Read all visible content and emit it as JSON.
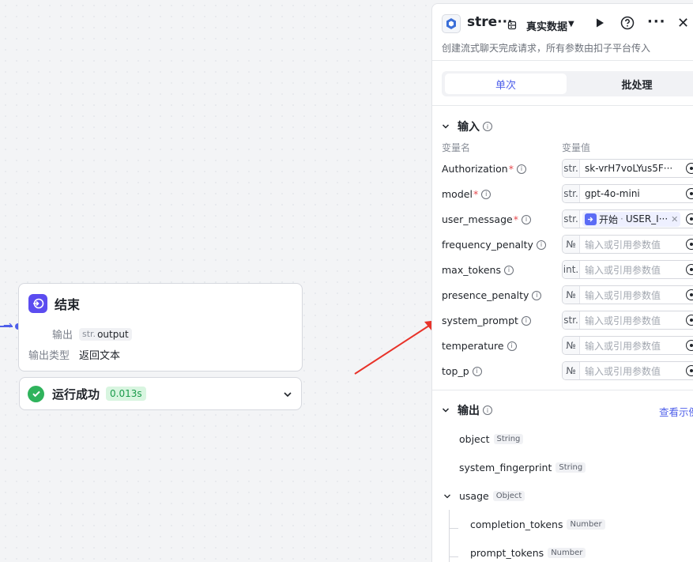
{
  "end_node": {
    "title": "结束",
    "output_label": "输出",
    "output_type_tag": "str.",
    "output_var": "output",
    "output_type_label": "输出类型",
    "output_type_value": "返回文本"
  },
  "run_status": {
    "text": "运行成功",
    "time": "0.013s"
  },
  "panel": {
    "title": "stre···",
    "mode": "真实数据",
    "description": "创建流式聊天完成请求，所有参数由扣子平台传入",
    "tabs": [
      "单次",
      "批处理"
    ],
    "input_section": "输入",
    "col_name": "变量名",
    "col_value": "变量值",
    "params": [
      {
        "name": "Authorization",
        "required": "*",
        "type": "str.",
        "value": "sk-vrH7voLYus5F···",
        "placeholder": ""
      },
      {
        "name": "model",
        "required": "*",
        "type": "str.",
        "value": "gpt-4o-mini",
        "placeholder": ""
      },
      {
        "name": "user_message",
        "required": "*",
        "type": "str.",
        "value": "",
        "placeholder": "",
        "ref_node": "开始",
        "ref_var": "USER_I···"
      },
      {
        "name": "frequency_penalty",
        "required": "",
        "type": "№",
        "value": "",
        "placeholder": "输入或引用参数值"
      },
      {
        "name": "max_tokens",
        "required": "",
        "type": "int.",
        "value": "",
        "placeholder": "输入或引用参数值"
      },
      {
        "name": "presence_penalty",
        "required": "",
        "type": "№",
        "value": "",
        "placeholder": "输入或引用参数值"
      },
      {
        "name": "system_prompt",
        "required": "",
        "type": "str.",
        "value": "",
        "placeholder": "输入或引用参数值"
      },
      {
        "name": "temperature",
        "required": "",
        "type": "№",
        "value": "",
        "placeholder": "输入或引用参数值"
      },
      {
        "name": "top_p",
        "required": "",
        "type": "№",
        "value": "",
        "placeholder": "输入或引用参数值"
      }
    ],
    "output_section": "输出",
    "example_link": "查看示例",
    "outputs": [
      {
        "name": "object",
        "type": "String"
      },
      {
        "name": "system_fingerprint",
        "type": "String"
      },
      {
        "name": "usage",
        "type": "Object"
      },
      {
        "name": "completion_tokens",
        "type": "Number"
      },
      {
        "name": "prompt_tokens",
        "type": "Number"
      }
    ]
  },
  "colors": {
    "accent": "#4e5fea",
    "success": "#2fb35c",
    "required": "#e5484d",
    "annotation_arrow": "#e8332a"
  }
}
